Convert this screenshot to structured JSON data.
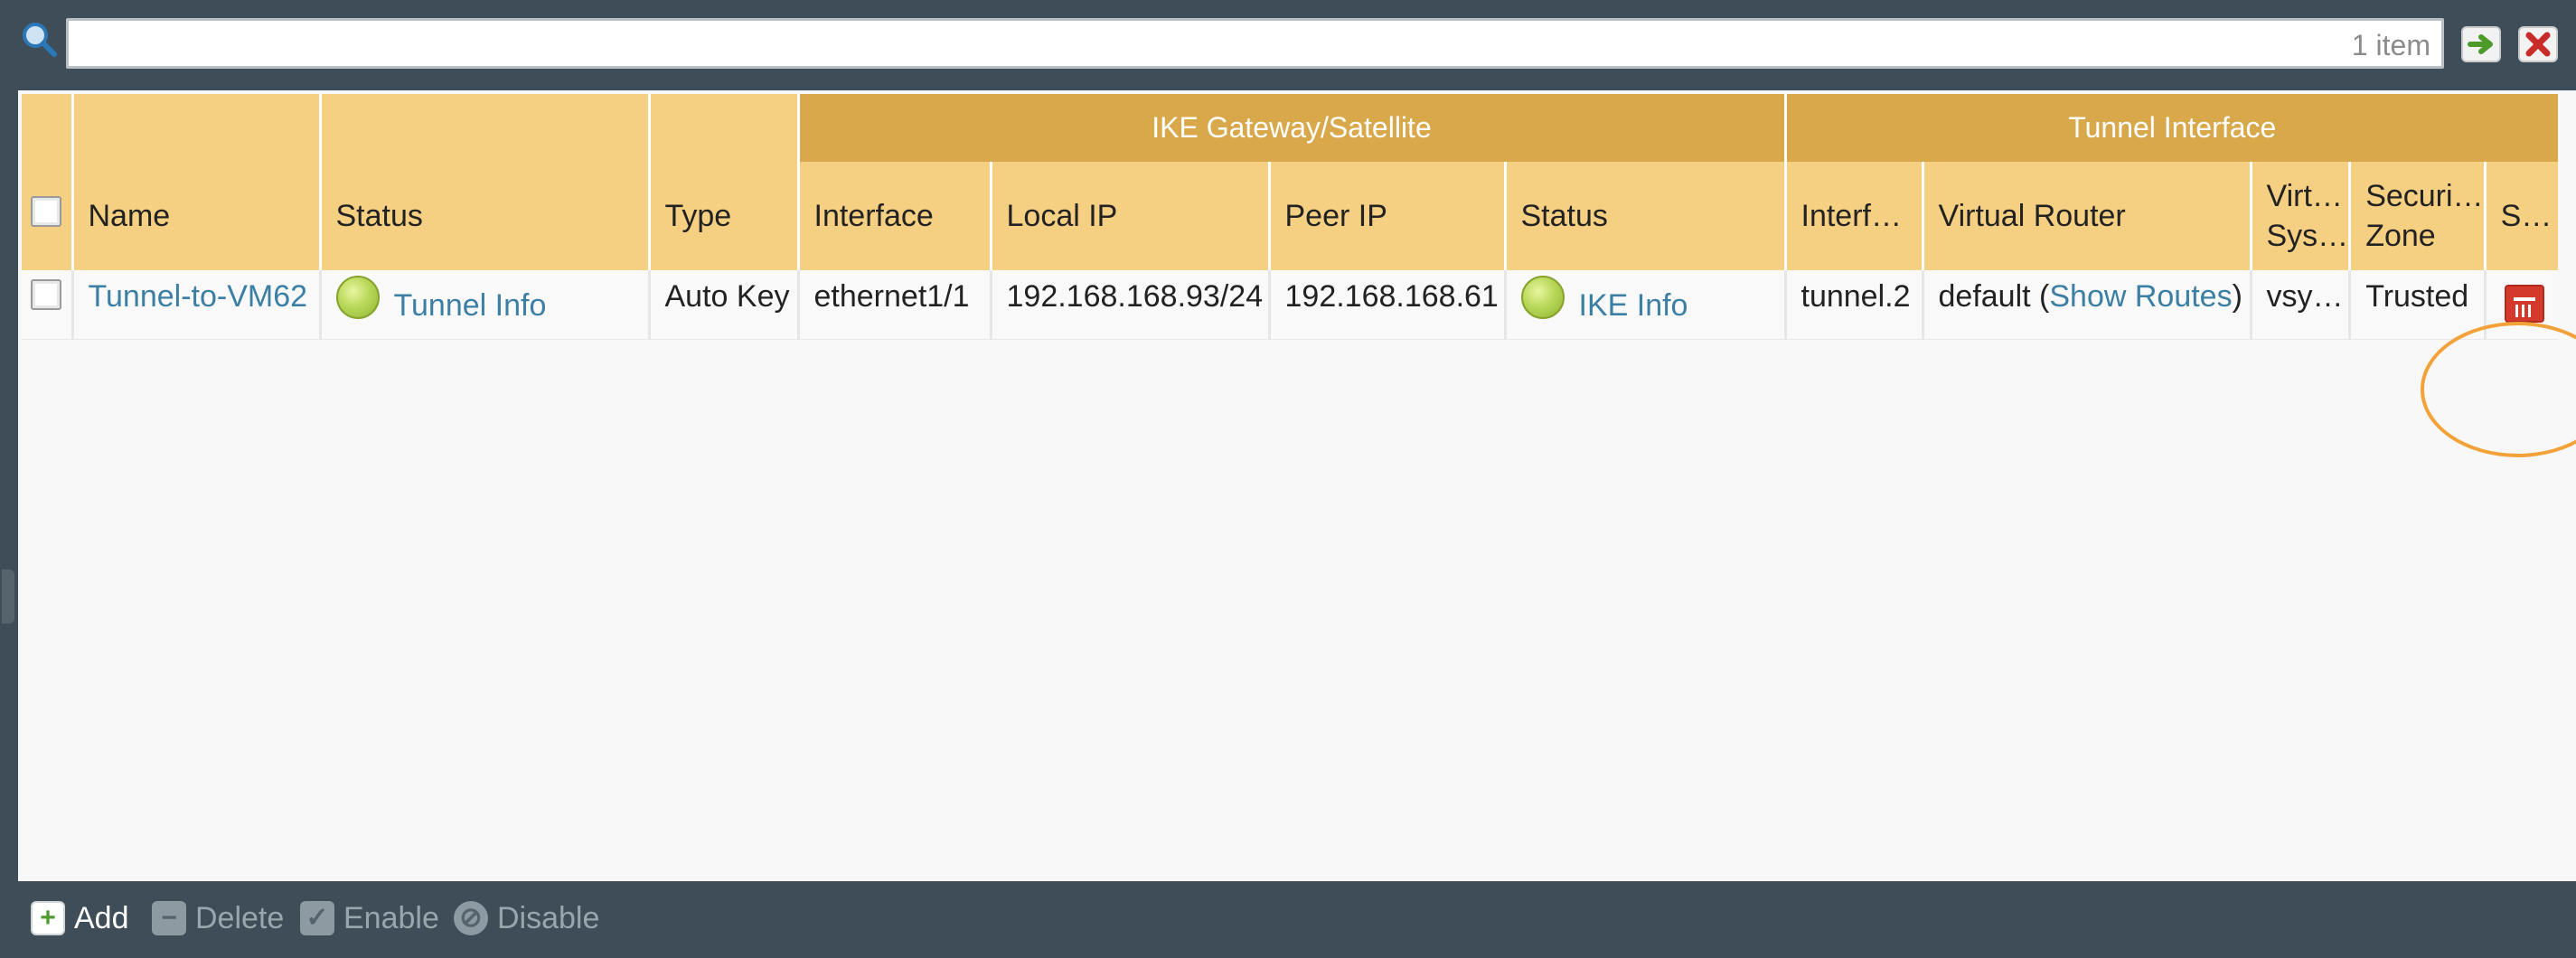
{
  "search": {
    "value": "",
    "count_label": "1 item"
  },
  "table": {
    "groups": {
      "ike_gateway": "IKE Gateway/Satellite",
      "tunnel_interface": "Tunnel Interface"
    },
    "columns": {
      "name": "Name",
      "status": "Status",
      "type": "Type",
      "interface": "Interface",
      "local_ip": "Local IP",
      "peer_ip": "Peer IP",
      "ike_status": "Status",
      "tunnel_interface": "Interf…",
      "virtual_router": "Virtual Router",
      "virtual_system": "Virt… Sys…",
      "security_zone": "Securi… Zone",
      "s": "S…"
    },
    "rows": [
      {
        "name": "Tunnel-to-VM62",
        "status_link": "Tunnel Info",
        "status_color": "#a9cc48",
        "type": "Auto Key",
        "interface": "ethernet1/1",
        "local_ip": "192.168.168.93/24",
        "peer_ip": "192.168.168.61",
        "ike_status_link": "IKE Info",
        "ike_status_color": "#a9cc48",
        "tunnel_interface": "tunnel.2",
        "virtual_router_prefix": "default (",
        "virtual_router_link": "Show Routes",
        "virtual_router_suffix": ")",
        "virtual_system": "vsy…",
        "security_zone": "Trusted",
        "s_icon": "red-status-icon"
      }
    ]
  },
  "toolbar": {
    "add_label": "Add",
    "delete_label": "Delete",
    "enable_label": "Enable",
    "disable_label": "Disable"
  }
}
